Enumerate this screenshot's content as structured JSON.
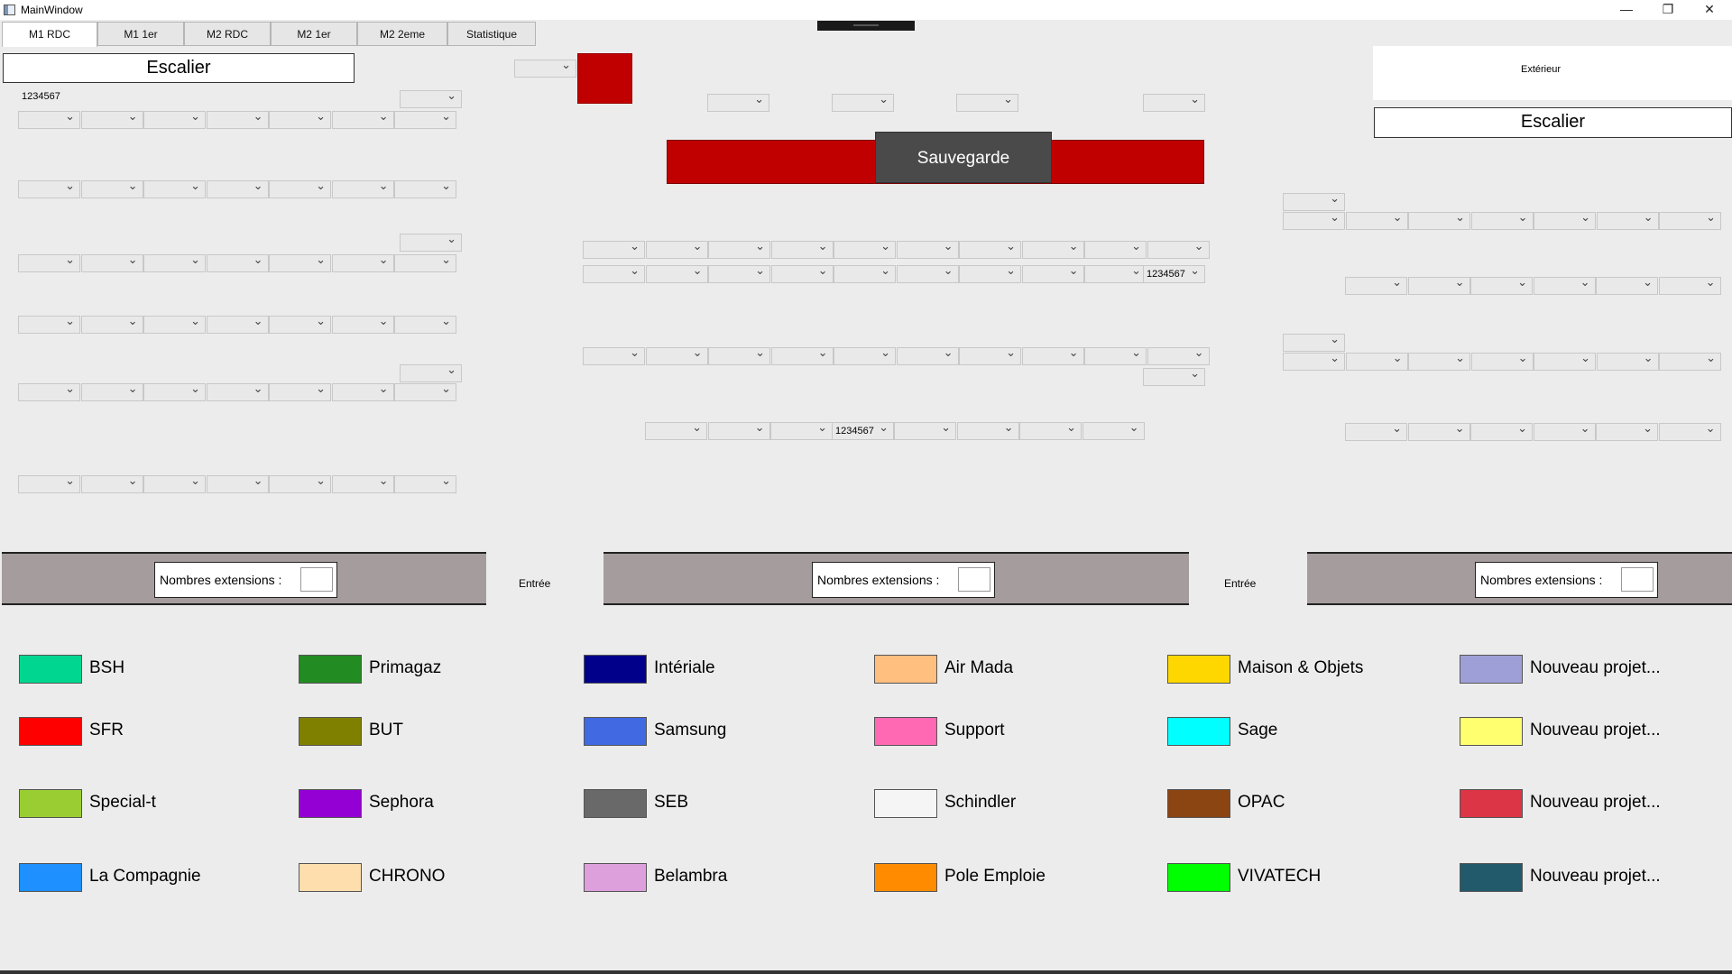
{
  "window": {
    "title": "MainWindow",
    "minimize_glyph": "—",
    "maximize_glyph": "❐",
    "close_glyph": "✕"
  },
  "tabs": [
    {
      "label": "M1 RDC",
      "active": true
    },
    {
      "label": "M1 1er"
    },
    {
      "label": "M2 RDC"
    },
    {
      "label": "M2 1er"
    },
    {
      "label": "M2 2eme"
    },
    {
      "label": "Statistique"
    }
  ],
  "left": {
    "escalier": "Escalier",
    "code_label": "1234567"
  },
  "right": {
    "exterieur": "Extérieur",
    "escalier": "Escalier"
  },
  "center": {
    "save_label": "Sauvegarde",
    "combo_value_1": "1234567",
    "combo_value_2": "1234567"
  },
  "extensions": {
    "label": "Nombres extensions :",
    "entree_label": "Entrée"
  },
  "colors": {
    "accent_red": "#c00000",
    "save_button": "#4a4a4a",
    "extension_bar": "#a59d9d"
  },
  "legend": [
    {
      "name": "BSH",
      "color": "#00d68f"
    },
    {
      "name": "Primagaz",
      "color": "#228b22"
    },
    {
      "name": "Intériale",
      "color": "#00008b"
    },
    {
      "name": "Air Mada",
      "color": "#ffbf7f"
    },
    {
      "name": "Maison & Objets",
      "color": "#ffd700"
    },
    {
      "name": "Nouveau projet...",
      "color": "#9f9fd8"
    },
    {
      "name": "SFR",
      "color": "#ff0000"
    },
    {
      "name": "BUT",
      "color": "#808000"
    },
    {
      "name": "Samsung",
      "color": "#4169e1"
    },
    {
      "name": "Support",
      "color": "#ff69b4"
    },
    {
      "name": "Sage",
      "color": "#00ffff"
    },
    {
      "name": "Nouveau projet...",
      "color": "#ffff6f"
    },
    {
      "name": "Special-t",
      "color": "#9acd32"
    },
    {
      "name": "Sephora",
      "color": "#9400d3"
    },
    {
      "name": "SEB",
      "color": "#696969"
    },
    {
      "name": "Schindler",
      "color": "#f5f5f5"
    },
    {
      "name": "OPAC",
      "color": "#8b4513"
    },
    {
      "name": "Nouveau projet...",
      "color": "#dc3545"
    },
    {
      "name": "La Compagnie",
      "color": "#1e90ff"
    },
    {
      "name": "CHRONO",
      "color": "#ffdead"
    },
    {
      "name": "Belambra",
      "color": "#dda0dd"
    },
    {
      "name": "Pole Emploie",
      "color": "#ff8c00"
    },
    {
      "name": "VIVATECH",
      "color": "#00ff00"
    },
    {
      "name": "Nouveau projet...",
      "color": "#235a6b"
    }
  ]
}
